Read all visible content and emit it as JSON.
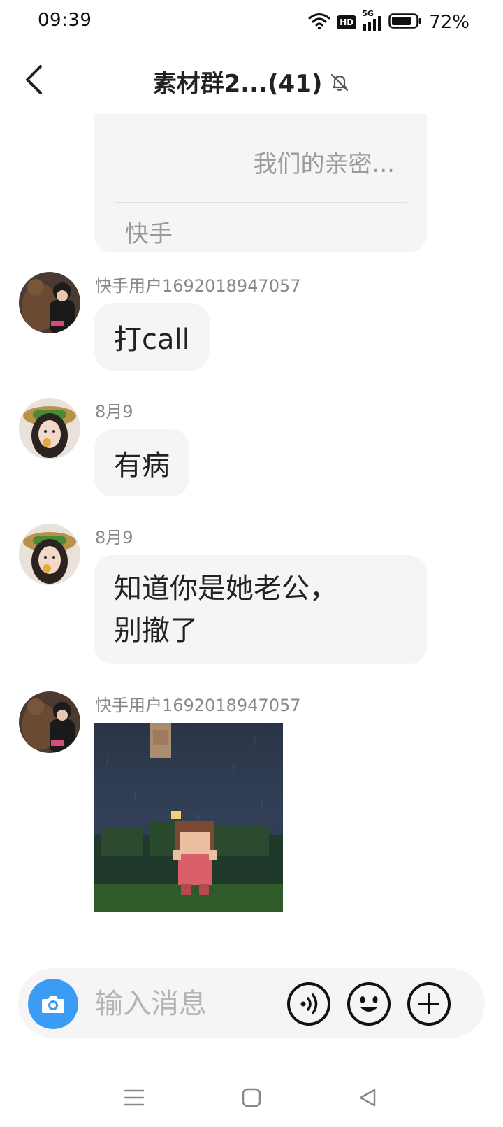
{
  "status_bar": {
    "time": "09:39",
    "network": "5G",
    "hd": "HD",
    "battery": "72%",
    "icons": [
      "wifi-icon",
      "hd-icon",
      "signal-5g-icon",
      "battery-icon"
    ]
  },
  "header": {
    "title": "素材群2...(41)",
    "back_icon": "chevron-left-icon",
    "mute_icon": "bell-off-icon"
  },
  "shared_card": {
    "text": "我们的亲密...",
    "source": "快手"
  },
  "messages": [
    {
      "sender": "快手用户1692018947057",
      "type": "text",
      "text": "打call"
    },
    {
      "sender": "8月9",
      "type": "text",
      "text": "有病"
    },
    {
      "sender": "8月9",
      "type": "text",
      "lines": [
        "知道你是她老公，",
        "别撤了"
      ]
    },
    {
      "sender": "快手用户1692018947057",
      "type": "image"
    }
  ],
  "input": {
    "placeholder": "输入消息",
    "value": "",
    "camera_icon": "camera-icon",
    "voice_icon": "voice-icon",
    "emoji_icon": "emoji-icon",
    "plus_icon": "plus-icon"
  },
  "system_nav": [
    "menu-icon",
    "home-square-icon",
    "back-triangle-icon"
  ],
  "colors": {
    "accent": "#3b9cf5",
    "bubble": "#f5f5f5",
    "muted_text": "#888888",
    "placeholder": "#b4b4b4"
  }
}
